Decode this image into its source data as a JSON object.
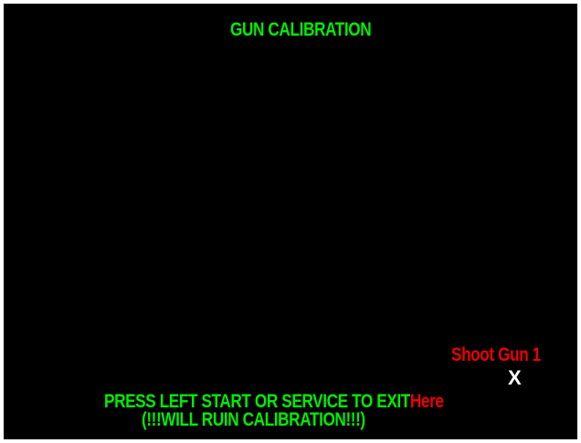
{
  "title": "GUN CALIBRATION",
  "target": {
    "label": "Shoot Gun 1",
    "marker": "X",
    "suffix": "Here"
  },
  "instructions": {
    "exit": "PRESS LEFT START OR SERVICE TO EXIT",
    "warning": "(!!!WILL RUIN CALIBRATION!!!)"
  },
  "colors": {
    "background": "#000000",
    "primary_text": "#00ee00",
    "target_text": "#ee0000",
    "marker": "#ffffff"
  }
}
